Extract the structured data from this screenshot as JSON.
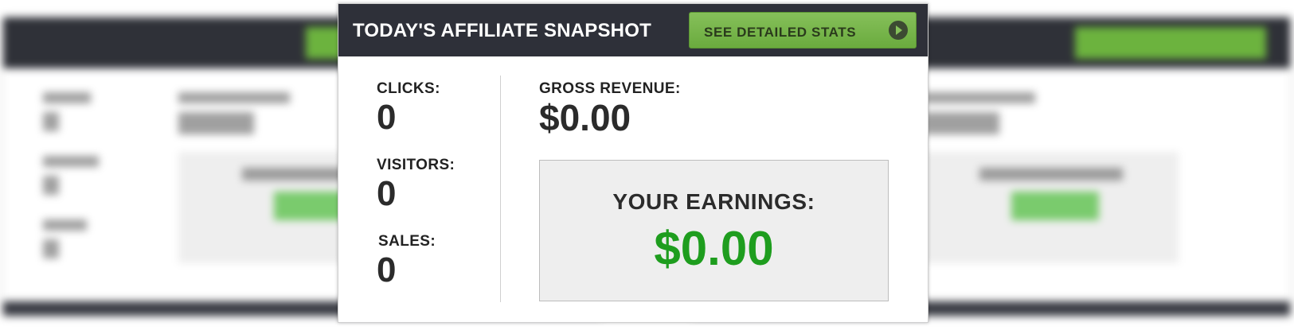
{
  "header": {
    "title": "TODAY'S AFFILIATE SNAPSHOT",
    "stats_button_label": "SEE DETAILED STATS"
  },
  "metrics": {
    "clicks": {
      "label": "CLICKS:",
      "value": "0"
    },
    "visitors": {
      "label": "VISITORS:",
      "value": "0"
    },
    "sales": {
      "label": "SALES:",
      "value": "0"
    },
    "gross_revenue": {
      "label": "GROSS REVENUE:",
      "value": "$0.00"
    }
  },
  "earnings": {
    "label": "YOUR EARNINGS:",
    "value": "$0.00"
  },
  "colors": {
    "header_bg": "#2e3039",
    "accent_green": "#6aab3e",
    "earnings_green": "#1e9d1e"
  },
  "icons": {
    "stats_button_icon": "play-circle-icon"
  }
}
